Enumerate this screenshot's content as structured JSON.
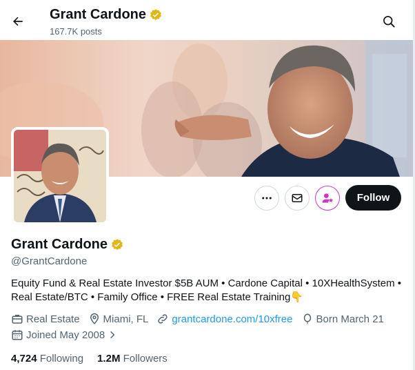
{
  "header": {
    "name": "Grant Cardone",
    "posts": "167.7K posts"
  },
  "profile": {
    "display_name": "Grant Cardone",
    "handle": "@GrantCardone",
    "bio": "Equity Fund & Real Estate Investor $5B AUM • Cardone Capital • 10XHealthSystem • Real Estate/BTC • Family Office • FREE Real Estate Training",
    "bio_emoji": "👇",
    "category": "Real Estate",
    "location": "Miami, FL",
    "website": "grantcardone.com/10xfree",
    "born": "Born March 21",
    "joined": "Joined May 2008",
    "following_count": "4,724",
    "following_label": "Following",
    "followers_count": "1.2M",
    "followers_label": "Followers"
  },
  "actions": {
    "follow_label": "Follow"
  },
  "icons": {
    "back": "arrow-left-icon",
    "search": "search-icon",
    "more": "more-icon",
    "message": "envelope-icon",
    "subscribe": "subscribe-icon",
    "verified": "verified-badge-icon",
    "category": "briefcase-icon",
    "location": "location-pin-icon",
    "link": "link-icon",
    "born": "balloon-icon",
    "joined": "calendar-icon"
  },
  "colors": {
    "text": "#0f1419",
    "secondary": "#536471",
    "link": "#1d9bf0",
    "verified_gold": "#e2b719",
    "subscribe_purple": "#c936cc",
    "follow_bg": "#0f1419"
  }
}
